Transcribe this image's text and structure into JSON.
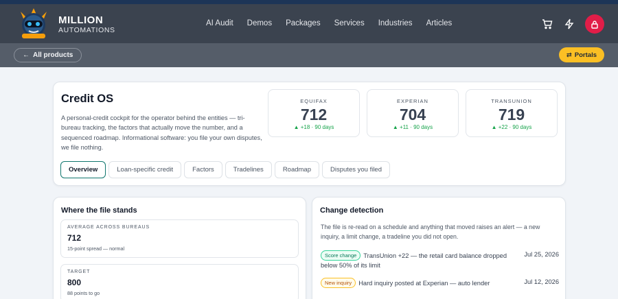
{
  "header": {
    "brand_line1": "MILLION",
    "brand_line2": "AUTOMATIONS",
    "nav": [
      "AI Audit",
      "Demos",
      "Packages",
      "Services",
      "Industries",
      "Articles"
    ],
    "icons": [
      "cart-icon",
      "bolt-icon",
      "lock-icon"
    ]
  },
  "subbar": {
    "back_label": "All products",
    "portals_label": "Portals"
  },
  "hero": {
    "title": "Credit OS",
    "description": "A personal-credit cockpit for the operator behind the entities — tri-bureau tracking, the factors that actually move the number, and a sequenced roadmap. Informational software: you file your own disputes, we file nothing.",
    "scores": [
      {
        "name": "EQUIFAX",
        "value": "712",
        "delta": "▲ +18 · 90 days"
      },
      {
        "name": "EXPERIAN",
        "value": "704",
        "delta": "▲ +11 · 90 days"
      },
      {
        "name": "TRANSUNION",
        "value": "719",
        "delta": "▲ +22 · 90 days"
      }
    ],
    "tabs": [
      "Overview",
      "Loan-specific credit",
      "Factors",
      "Tradelines",
      "Roadmap",
      "Disputes you filed"
    ],
    "active_tab": "Overview"
  },
  "file_stands": {
    "title": "Where the file stands",
    "stats": [
      {
        "label": "AVERAGE ACROSS BUREAUS",
        "value": "712",
        "note": "15-point spread — normal"
      },
      {
        "label": "TARGET",
        "value": "800",
        "note": "88 points to go"
      }
    ]
  },
  "change_detection": {
    "title": "Change detection",
    "description": "The file is re-read on a schedule and anything that moved raises an alert — a new inquiry, a limit change, a tradeline you did not open.",
    "alerts": [
      {
        "badge": "Score change",
        "text": "TransUnion +22 — the retail card balance dropped below 50% of its limit",
        "date": "Jul 25, 2026"
      },
      {
        "badge": "New inquiry",
        "text": "Hard inquiry posted at Experian — auto lender",
        "date": "Jul 12, 2026"
      }
    ]
  },
  "colors": {
    "header_bg": "#3b434f",
    "subbar_bg": "#555d69",
    "accent_yellow": "#fbbf24",
    "lock_red": "#e11d48",
    "active_tab_border": "#0f766e",
    "delta_green": "#16a34a"
  }
}
